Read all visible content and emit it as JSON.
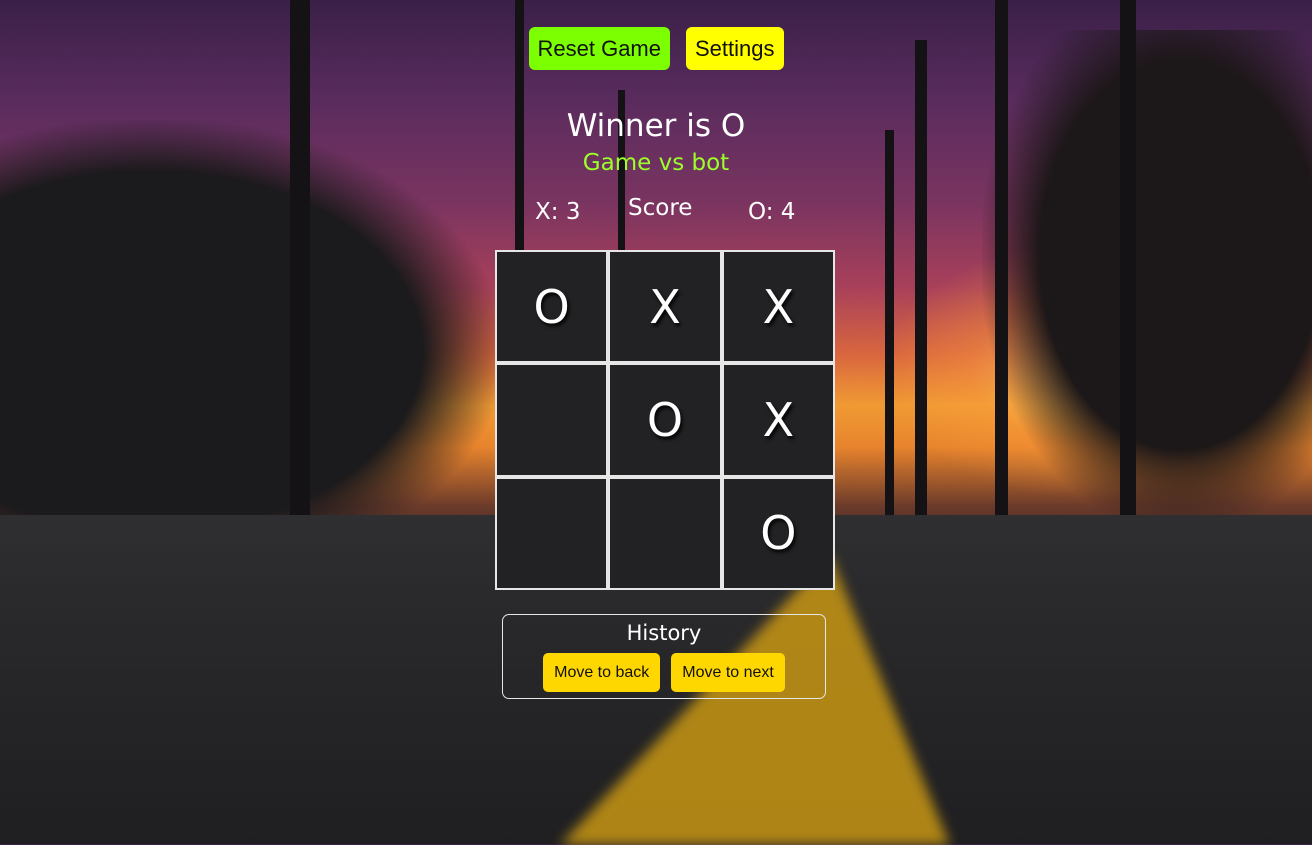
{
  "toolbar": {
    "reset_label": "Reset Game",
    "settings_label": "Settings"
  },
  "game": {
    "status": "Winner is O",
    "mode": "Game vs bot"
  },
  "score": {
    "x": "X: 3",
    "title": "Score",
    "o": "O: 4"
  },
  "board": [
    "O",
    "X",
    "X",
    "",
    "O",
    "X",
    "",
    "",
    "O"
  ],
  "history": {
    "title": "History",
    "back_label": "Move to back",
    "next_label": "Move to next"
  },
  "colors": {
    "reset_button": "#7cff00",
    "settings_button": "#ffff00",
    "mode_text": "#9cff2a",
    "history_button": "#ffd700",
    "cell_background": "#222123"
  }
}
